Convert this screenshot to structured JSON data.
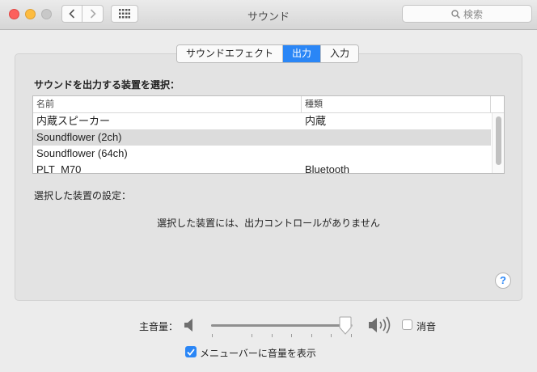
{
  "window": {
    "title": "サウンド",
    "search_placeholder": "検索"
  },
  "tabs": [
    {
      "label": "サウンドエフェクト",
      "active": false
    },
    {
      "label": "出力",
      "active": true
    },
    {
      "label": "入力",
      "active": false
    }
  ],
  "output": {
    "heading": "サウンドを出力する装置を選択：",
    "columns": {
      "name": "名前",
      "type": "種類"
    },
    "devices": [
      {
        "name": "内蔵スピーカー",
        "type": "内蔵",
        "selected": false
      },
      {
        "name": "Soundflower (2ch)",
        "type": "",
        "selected": true
      },
      {
        "name": "Soundflower (64ch)",
        "type": "",
        "selected": false
      },
      {
        "name": "PLT_M70",
        "type": "Bluetooth",
        "selected": false
      }
    ],
    "settings_label": "選択した装置の設定：",
    "no_controls_message": "選択した装置には、出力コントロールがありません",
    "help": "?"
  },
  "volume": {
    "label": "主音量：",
    "level_fraction": 0.95,
    "mute_label": "消音",
    "muted": false
  },
  "menubar_option": {
    "label": "メニューバーに音量を表示",
    "checked": true
  },
  "colors": {
    "accent": "#2a86f6",
    "selection_row": "#dcdcdc",
    "traffic_close": "#fc605c",
    "traffic_min": "#fdbc40"
  },
  "icons": [
    "back-chevron-icon",
    "forward-chevron-icon",
    "grid-icon",
    "search-icon",
    "speaker-low-icon",
    "speaker-high-icon",
    "checkmark-icon",
    "help-icon"
  ]
}
